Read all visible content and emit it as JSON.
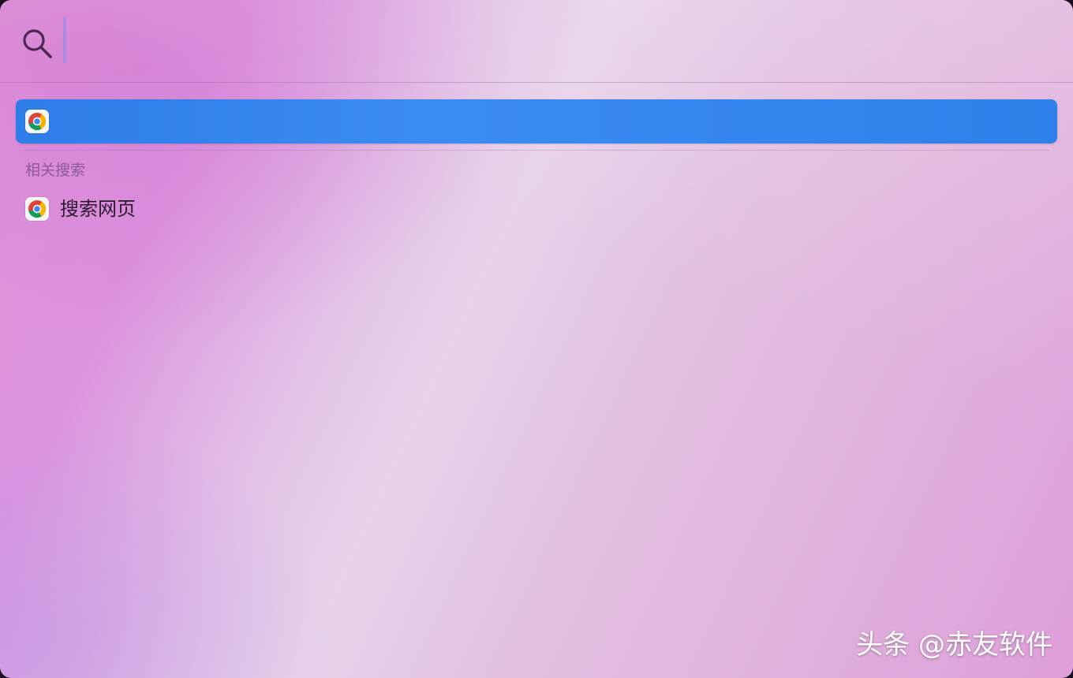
{
  "search": {
    "query": "",
    "query_highlight_color": "#a98ce0"
  },
  "top_hit": {
    "title": "",
    "icon": "chrome-icon",
    "highlight_color": "#2f80ea"
  },
  "related": {
    "header": "相关搜索",
    "items": [
      {
        "label": "搜索网页",
        "icon": "chrome-icon"
      }
    ]
  },
  "watermark": "头条 @赤友软件"
}
